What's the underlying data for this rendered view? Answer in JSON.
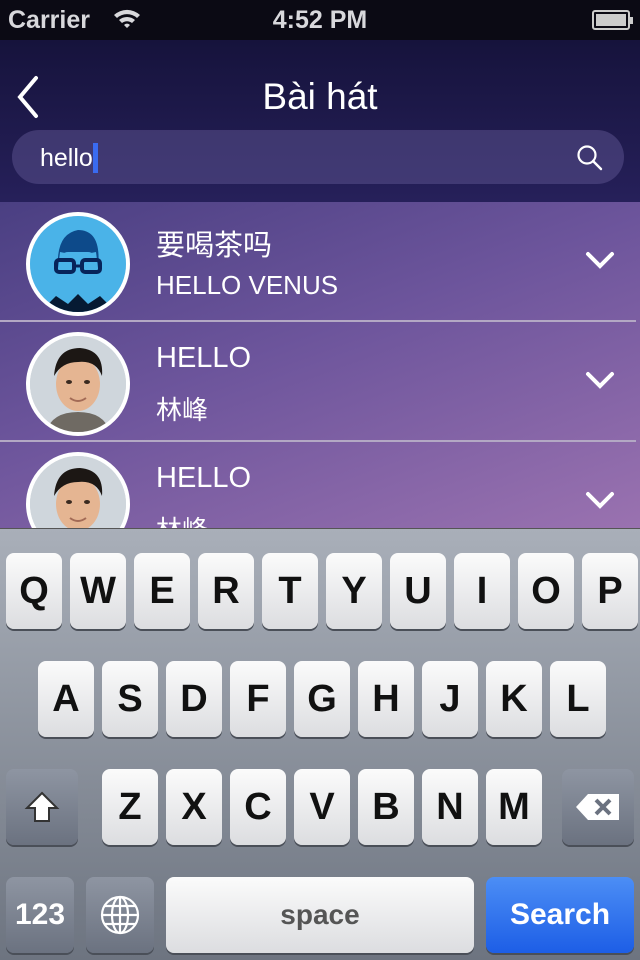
{
  "status": {
    "carrier": "Carrier",
    "time": "4:52 PM",
    "battery_level": 1.0
  },
  "header": {
    "title": "Bài hát"
  },
  "search": {
    "value": "hello"
  },
  "results": [
    {
      "title": "要喝茶吗",
      "subtitle": "HELLO VENUS",
      "avatar": "cartoon"
    },
    {
      "title": "HELLO",
      "subtitle": "林峰",
      "avatar": "photo"
    },
    {
      "title": "HELLO",
      "subtitle": "林峰",
      "avatar": "photo"
    }
  ],
  "keyboard": {
    "row1": [
      "Q",
      "W",
      "E",
      "R",
      "T",
      "Y",
      "U",
      "I",
      "O",
      "P"
    ],
    "row2": [
      "A",
      "S",
      "D",
      "F",
      "G",
      "H",
      "J",
      "K",
      "L"
    ],
    "row3": [
      "Z",
      "X",
      "C",
      "V",
      "B",
      "N",
      "M"
    ],
    "numbers_label": "123",
    "space_label": "space",
    "search_label": "Search"
  },
  "colors": {
    "accent": "#1d5ee6",
    "caret": "#3a6bf0"
  }
}
